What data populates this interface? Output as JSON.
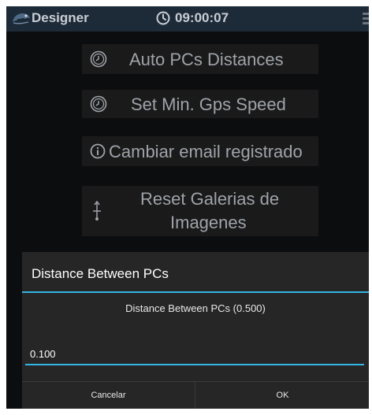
{
  "topbar": {
    "app_title": "Designer",
    "time": "09:00:07",
    "logo_icon": "chameleon-logo-icon",
    "clock_icon": "clock-icon",
    "menu_icon": "overflow-menu-icon"
  },
  "menu": {
    "auto_pcs_distances": "Auto PCs Distances",
    "set_min_gps_speed": "Set Min. Gps Speed",
    "cambiar_email": "Cambiar email registrado",
    "reset_galerias_line1": "Reset Galerias de",
    "reset_galerias_line2": "Imagenes"
  },
  "dialog": {
    "title": "Distance Between PCs",
    "message": "Distance Between PCs (0.500)",
    "input_value": "0.100",
    "cancel_label": "Cancelar",
    "ok_label": "OK"
  },
  "colors": {
    "accent": "#33b5e5",
    "topbar_bg": "#1d2a38",
    "dialog_bg": "#262626",
    "screen_bg": "#0c0d0f"
  }
}
